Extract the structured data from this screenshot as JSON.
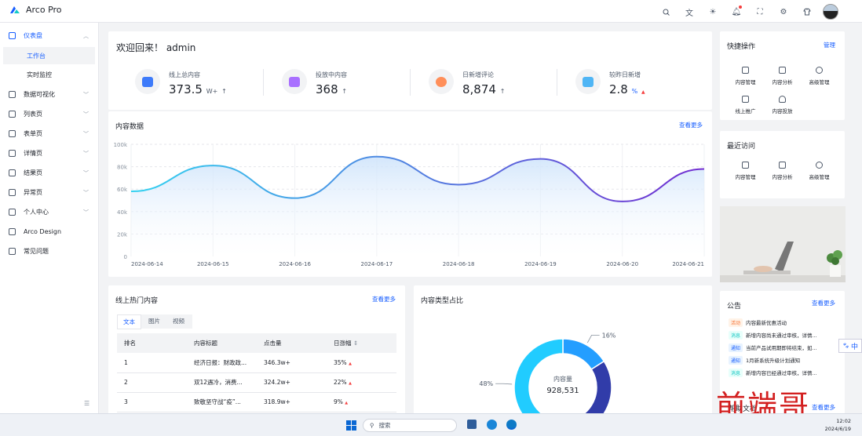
{
  "app": {
    "title": "Arco Pro"
  },
  "sidebar": {
    "items": [
      {
        "label": "仪表盘",
        "icon": "dashboard-icon",
        "expanded": true
      },
      {
        "label": "数据可视化",
        "icon": "chart-icon"
      },
      {
        "label": "列表页",
        "icon": "list-icon"
      },
      {
        "label": "表单页",
        "icon": "settings-icon"
      },
      {
        "label": "详情页",
        "icon": "file-icon"
      },
      {
        "label": "结果页",
        "icon": "check-circle-icon"
      },
      {
        "label": "异常页",
        "icon": "exclamation-icon"
      },
      {
        "label": "个人中心",
        "icon": "user-icon"
      },
      {
        "label": "Arco Design",
        "icon": "link-icon"
      },
      {
        "label": "常见问题",
        "icon": "question-icon"
      }
    ],
    "sub_items": [
      {
        "label": "工作台",
        "active": true
      },
      {
        "label": "实时监控",
        "active": false
      }
    ]
  },
  "welcome": {
    "greeting": "欢迎回来！ admin",
    "stats": [
      {
        "label": "线上总内容",
        "value": "373.5",
        "unit": "W+",
        "trend": "↑",
        "color": "#3e7bfa"
      },
      {
        "label": "投放中内容",
        "value": "368",
        "unit": "",
        "trend": "↑",
        "color": "#a970ff"
      },
      {
        "label": "日新增评论",
        "value": "8,874",
        "unit": "",
        "trend": "↑",
        "color": "#ff8f5a"
      },
      {
        "label": "较昨日新增",
        "value": "2.8",
        "unit": "%",
        "trend": "▲",
        "color": "#4fb5f5"
      }
    ]
  },
  "content_chart": {
    "title": "内容数据",
    "more": "查看更多"
  },
  "chart_data": [
    {
      "type": "area",
      "title": "内容数据",
      "x": [
        "2024-06-14",
        "2024-06-15",
        "2024-06-16",
        "2024-06-17",
        "2024-06-18",
        "2024-06-19",
        "2024-06-20",
        "2024-06-21"
      ],
      "y_ticks": [
        "0",
        "20k",
        "40k",
        "60k",
        "80k",
        "100k"
      ],
      "ylim": [
        0,
        100000
      ],
      "series": [
        {
          "values": [
            58000,
            81000,
            52000,
            89000,
            64000,
            87000,
            49000,
            78000
          ]
        }
      ],
      "colors": [
        "#33d1f0",
        "#722ed1"
      ]
    },
    {
      "type": "pie",
      "title": "内容类型占比",
      "center_label": "内容量",
      "center_value": "928,531",
      "slices": [
        {
          "value": 16,
          "label": "16%",
          "color": "#249eff"
        },
        {
          "value": 36,
          "label": "36%",
          "color": "#313ca9"
        },
        {
          "value": 48,
          "label": "48%",
          "color": "#21ccff"
        }
      ]
    }
  ],
  "hot": {
    "title": "线上热门内容",
    "more": "查看更多",
    "tabs": [
      "文本",
      "图片",
      "视频"
    ],
    "columns": [
      "排名",
      "内容标题",
      "点击量",
      "日涨幅"
    ],
    "sort_icon": "⇕",
    "rows": [
      {
        "rank": "1",
        "title": "经济日报：财政政...",
        "clicks": "346.3w+",
        "rise": "35%",
        "arrow": "▲"
      },
      {
        "rank": "2",
        "title": "双12遇冷，消费...",
        "clicks": "324.2w+",
        "rise": "22%",
        "arrow": "▲"
      },
      {
        "rank": "3",
        "title": "致敬坚守战“疫”...",
        "clicks": "318.9w+",
        "rise": "9%",
        "arrow": "▲"
      }
    ]
  },
  "donut": {
    "title": "内容类型占比"
  },
  "quick": {
    "title": "快捷操作",
    "manage": "管理",
    "items": [
      "内容管理",
      "内容分析",
      "高级管理",
      "线上推广",
      "内容投放"
    ]
  },
  "recent": {
    "title": "最近访问",
    "items": [
      "内容管理",
      "内容分析",
      "高级管理"
    ]
  },
  "notice": {
    "title": "公告",
    "more": "查看更多",
    "items": [
      {
        "tag": "活动",
        "text": "内容最新优惠活动",
        "tag_color": "#f77234",
        "tag_bg": "#fff3e8"
      },
      {
        "tag": "消息",
        "text": "新增内容尚未通过审核，详情...",
        "tag_color": "#0fc6c2",
        "tag_bg": "#e8fffb"
      },
      {
        "tag": "通知",
        "text": "当前产品试用期即将结束，如...",
        "tag_color": "#165dff",
        "tag_bg": "#e8f3ff"
      },
      {
        "tag": "通知",
        "text": "1月新系统升级计划通知",
        "tag_color": "#165dff",
        "tag_bg": "#e8f3ff"
      },
      {
        "tag": "消息",
        "text": "新增内容已经通过审核，详情...",
        "tag_color": "#0fc6c2",
        "tag_bg": "#e8fffb"
      }
    ]
  },
  "docs": {
    "title": "帮助文档",
    "more": "查看更多"
  },
  "taskbar": {
    "search": "搜索",
    "time": "12:02",
    "date": "2024/6/19"
  },
  "ime": {
    "label": "中"
  },
  "watermark": {
    "text": "前端哥"
  }
}
